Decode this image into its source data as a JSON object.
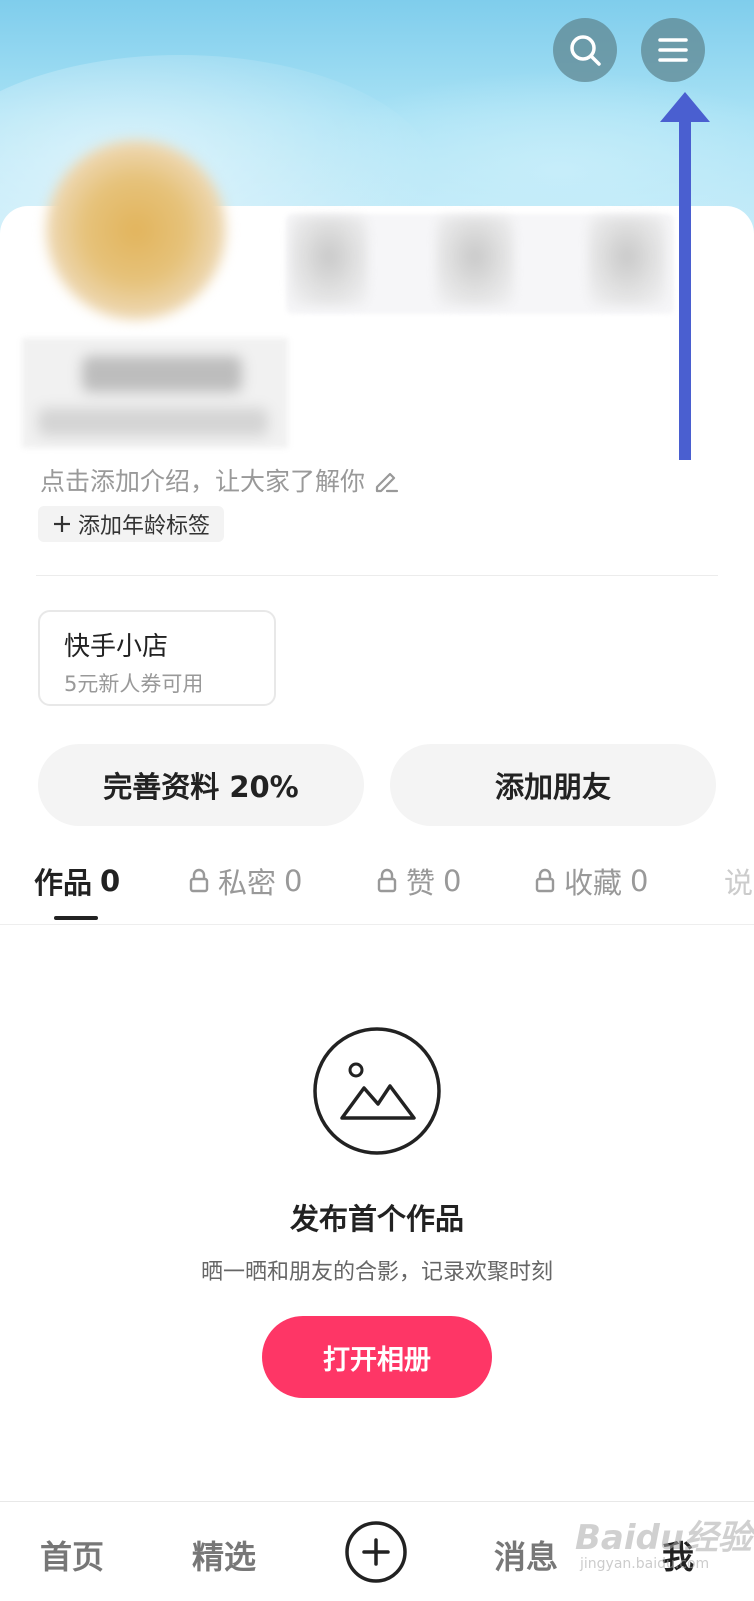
{
  "header": {
    "search_icon": "search-icon",
    "menu_icon": "menu-icon"
  },
  "profile": {
    "bio_placeholder": "点击添加介绍，让大家了解你",
    "age_tag_label": "添加年龄标签"
  },
  "shop": {
    "title": "快手小店",
    "subtitle": "5元新人券可用"
  },
  "actions": {
    "complete_profile": "完善资料 20%",
    "add_friends": "添加朋友"
  },
  "tabs": [
    {
      "label": "作品",
      "count": "0",
      "locked": false,
      "active": true
    },
    {
      "label": "私密",
      "count": "0",
      "locked": true,
      "active": false
    },
    {
      "label": "赞",
      "count": "0",
      "locked": true,
      "active": false
    },
    {
      "label": "收藏",
      "count": "0",
      "locked": true,
      "active": false
    },
    {
      "label": "说",
      "count": "",
      "locked": false,
      "active": false
    }
  ],
  "empty_state": {
    "title": "发布首个作品",
    "description": "晒一晒和朋友的合影，记录欢聚时刻",
    "button": "打开相册"
  },
  "bottom_nav": {
    "home": "首页",
    "featured": "精选",
    "messages": "消息",
    "me": "我"
  },
  "watermark": {
    "text": "Baidu经验",
    "sub": "jingyan.baidu.com"
  },
  "colors": {
    "accent": "#fe3666",
    "annotation_arrow": "#4a5fd0"
  }
}
